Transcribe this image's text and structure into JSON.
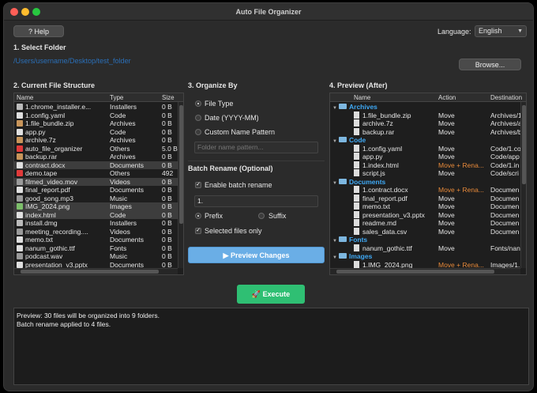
{
  "window": {
    "title": "Auto File Organizer"
  },
  "header": {
    "help_label": "? Help",
    "language_label": "Language:",
    "language_value": "English"
  },
  "select_folder": {
    "title": "1. Select Folder",
    "path": "/Users/username/Desktop/test_folder",
    "browse_label": "Browse..."
  },
  "structure": {
    "title": "2. Current File Structure",
    "columns": [
      "Name",
      "Type",
      "Size"
    ],
    "rows": [
      {
        "name": "1.chrome_installer.e...",
        "type": "Installers",
        "size": "0 B",
        "icon": "gear-icon",
        "color": "#bbbbbb"
      },
      {
        "name": "1.config.yaml",
        "type": "Code",
        "size": "0 B",
        "icon": "file-icon",
        "color": "#e0e0e0"
      },
      {
        "name": "1.file_bundle.zip",
        "type": "Archives",
        "size": "0 B",
        "icon": "box-icon",
        "color": "#c8955a"
      },
      {
        "name": "app.py",
        "type": "Code",
        "size": "0 B",
        "icon": "file-icon",
        "color": "#e0e0e0"
      },
      {
        "name": "archive.7z",
        "type": "Archives",
        "size": "0 B",
        "icon": "box-icon",
        "color": "#c8955a"
      },
      {
        "name": "auto_file_organizer",
        "type": "Others",
        "size": "5.0 B",
        "icon": "question-icon",
        "color": "#e03a3a"
      },
      {
        "name": "backup.rar",
        "type": "Archives",
        "size": "0 B",
        "icon": "box-icon",
        "color": "#c8955a"
      },
      {
        "name": "contract.docx",
        "type": "Documents",
        "size": "0 B",
        "icon": "file-icon",
        "color": "#e0e0e0"
      },
      {
        "name": "demo.tape",
        "type": "Others",
        "size": "492",
        "icon": "question-icon",
        "color": "#e03a3a"
      },
      {
        "name": "filmed_video.mov",
        "type": "Videos",
        "size": "0 B",
        "icon": "video-icon",
        "color": "#9a9a9a"
      },
      {
        "name": "final_report.pdf",
        "type": "Documents",
        "size": "0 B",
        "icon": "file-icon",
        "color": "#e0e0e0"
      },
      {
        "name": "good_song.mp3",
        "type": "Music",
        "size": "0 B",
        "icon": "music-icon",
        "color": "#9a9a9a"
      },
      {
        "name": "IMG_2024.png",
        "type": "Images",
        "size": "0 B",
        "icon": "image-icon",
        "color": "#7cbf6a"
      },
      {
        "name": "index.html",
        "type": "Code",
        "size": "0 B",
        "icon": "file-icon",
        "color": "#e0e0e0"
      },
      {
        "name": "install.dmg",
        "type": "Installers",
        "size": "0 B",
        "icon": "gear-icon",
        "color": "#bbbbbb"
      },
      {
        "name": "meeting_recording....",
        "type": "Videos",
        "size": "0 B",
        "icon": "video-icon",
        "color": "#9a9a9a"
      },
      {
        "name": "memo.txt",
        "type": "Documents",
        "size": "0 B",
        "icon": "file-icon",
        "color": "#e0e0e0"
      },
      {
        "name": "nanum_gothic.ttf",
        "type": "Fonts",
        "size": "0 B",
        "icon": "file-icon",
        "color": "#e0e0e0"
      },
      {
        "name": "podcast.wav",
        "type": "Music",
        "size": "0 B",
        "icon": "music-icon",
        "color": "#9a9a9a"
      },
      {
        "name": "presentation_v3.pptx",
        "type": "Documents",
        "size": "0 B",
        "icon": "file-icon",
        "color": "#e0e0e0"
      }
    ]
  },
  "organize": {
    "title": "3. Organize By",
    "options": [
      "File Type",
      "Date (YYYY-MM)",
      "Custom Name Pattern"
    ],
    "selected": 0,
    "pattern_placeholder": "Folder name pattern..."
  },
  "batch": {
    "title": "Batch Rename (Optional)",
    "enable_label": "Enable batch rename",
    "value": "1.",
    "prefix_label": "Prefix",
    "suffix_label": "Suffix",
    "selected_only_label": "Selected files only",
    "preview_label": "▶ Preview Changes"
  },
  "preview": {
    "title": "4. Preview (After)",
    "columns": [
      "Name",
      "Action",
      "Destination"
    ],
    "rows": [
      {
        "kind": "group",
        "name": "Archives"
      },
      {
        "kind": "file",
        "name": "1.file_bundle.zip",
        "action": "Move",
        "dest": "Archives/1.",
        "rename": false
      },
      {
        "kind": "file",
        "name": "archive.7z",
        "action": "Move",
        "dest": "Archives/a",
        "rename": false
      },
      {
        "kind": "file",
        "name": "backup.rar",
        "action": "Move",
        "dest": "Archives/b",
        "rename": false
      },
      {
        "kind": "group",
        "name": "Code"
      },
      {
        "kind": "file",
        "name": "1.config.yaml",
        "action": "Move",
        "dest": "Code/1.co",
        "rename": false
      },
      {
        "kind": "file",
        "name": "app.py",
        "action": "Move",
        "dest": "Code/app",
        "rename": false
      },
      {
        "kind": "file",
        "name": "1.index.html",
        "action": "Move + Rena...",
        "dest": "Code/1.in",
        "rename": true
      },
      {
        "kind": "file",
        "name": "script.js",
        "action": "Move",
        "dest": "Code/scri",
        "rename": false
      },
      {
        "kind": "group",
        "name": "Documents"
      },
      {
        "kind": "file",
        "name": "1.contract.docx",
        "action": "Move + Rena...",
        "dest": "Documen",
        "rename": true
      },
      {
        "kind": "file",
        "name": "final_report.pdf",
        "action": "Move",
        "dest": "Documen",
        "rename": false
      },
      {
        "kind": "file",
        "name": "memo.txt",
        "action": "Move",
        "dest": "Documen",
        "rename": false
      },
      {
        "kind": "file",
        "name": "presentation_v3.pptx",
        "action": "Move",
        "dest": "Documen",
        "rename": false
      },
      {
        "kind": "file",
        "name": "readme.md",
        "action": "Move",
        "dest": "Documen",
        "rename": false
      },
      {
        "kind": "file",
        "name": "sales_data.csv",
        "action": "Move",
        "dest": "Documen",
        "rename": false
      },
      {
        "kind": "group",
        "name": "Fonts"
      },
      {
        "kind": "file",
        "name": "nanum_gothic.ttf",
        "action": "Move",
        "dest": "Fonts/nan",
        "rename": false
      },
      {
        "kind": "group",
        "name": "Images"
      },
      {
        "kind": "file",
        "name": "1.IMG_2024.png",
        "action": "Move + Rena...",
        "dest": "Images/1.",
        "rename": true
      }
    ]
  },
  "execute_label": "🚀 Execute",
  "log": {
    "lines": [
      "Preview: 30 files will be organized into 9 folders.",
      "Batch rename applied to 4 files."
    ]
  },
  "colors": {
    "accent": "#6aaee6",
    "execute": "#2fbf73",
    "group": "#3fa9f5",
    "rename": "#e88a3a"
  }
}
